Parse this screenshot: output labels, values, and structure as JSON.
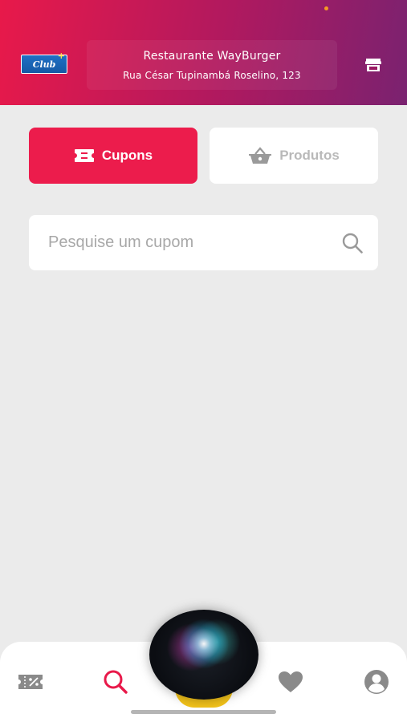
{
  "header": {
    "logo_text": "Club",
    "logo_plus": "+",
    "store_name": "Restaurante WayBurger",
    "store_address": "Rua César Tupinambá Roselino, 123",
    "store_icon": "store-icon",
    "gradient_colors": [
      "#e8194a",
      "#b0195f",
      "#7a2270"
    ]
  },
  "tabs": [
    {
      "label": "Cupons",
      "icon": "ticket-icon",
      "active": true
    },
    {
      "label": "Produtos",
      "icon": "basket-icon",
      "active": false
    }
  ],
  "search": {
    "placeholder": "Pesquise um cupom",
    "value": "",
    "icon": "search-icon"
  },
  "bottom_nav": {
    "items": [
      {
        "icon": "coupon-percent-icon",
        "active": false
      },
      {
        "icon": "search-icon",
        "active": true
      },
      {
        "icon": "siri-orb",
        "active": false
      },
      {
        "icon": "heart-icon",
        "active": false
      },
      {
        "icon": "profile-icon",
        "active": false
      }
    ]
  },
  "colors": {
    "accent": "#ec1c4c",
    "background": "#ebebeb",
    "inactive": "#b9b9b9",
    "nav_icon": "#8a8a8a"
  }
}
